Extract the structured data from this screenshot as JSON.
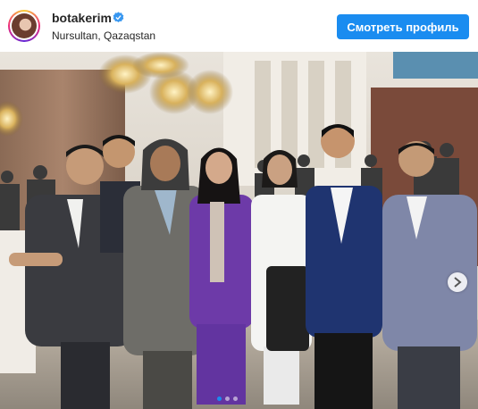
{
  "post": {
    "username": "botakerim",
    "location": "Nursultan, Qazaqstan",
    "follow_label": "Смотреть профиль",
    "verified_icon": "verified-badge-icon",
    "accent_color": "#1a8cf0",
    "carousel": {
      "slide_count": 3,
      "active_index": 0
    },
    "photo_description_icon": "group-photo"
  }
}
